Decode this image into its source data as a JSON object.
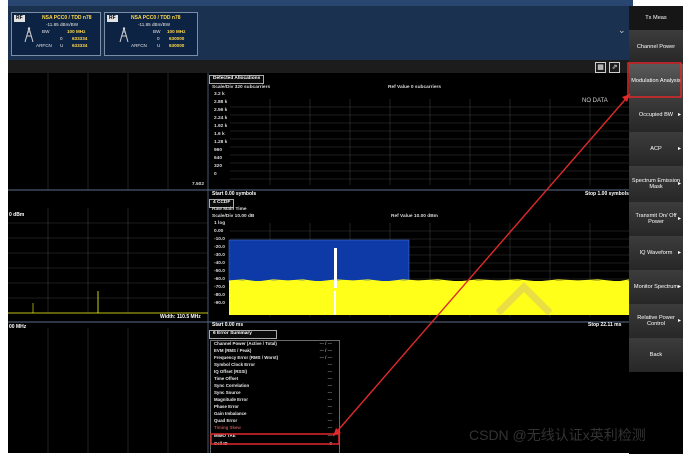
{
  "topbar": {
    "tile1": {
      "badge": "RF",
      "title": "NSA PCC0 / TDD  n78",
      "l1": "-11.85  dBm/BW",
      "l2a": "BW",
      "l2b": "100  MHz",
      "l3a": "0",
      "l3b": "633334",
      "l4a": "U",
      "l4b": "633334",
      "foot": "ARFCN"
    },
    "tile2": {
      "badge": "RF",
      "title": "NSA PCC0 / TDD  n78",
      "l1": "-11.85  dBm/BW",
      "l2a": "BW",
      "l2b": "100  MHz",
      "l3a": "0",
      "l3b": "630000",
      "l4a": "U",
      "l4b": "630000",
      "foot": "ARFCN"
    },
    "chevron": "⌄"
  },
  "softkeys": [
    {
      "label": "Tx Meas",
      "arrow": ""
    },
    {
      "label": "Channel Power",
      "arrow": ""
    },
    {
      "label": "Modulation Analysis",
      "arrow": ""
    },
    {
      "label": "Occupied BW",
      "arrow": "▸"
    },
    {
      "label": "ACP",
      "arrow": "▸"
    },
    {
      "label": "Spectrum Emission Mask",
      "arrow": "▸"
    },
    {
      "label": "Transmit On/ Off Power",
      "arrow": "▸"
    },
    {
      "label": "IQ Waveform",
      "arrow": "▸"
    },
    {
      "label": "Monitor Spectrum",
      "arrow": "▸"
    },
    {
      "label": "Relative Power Control",
      "arrow": "▸"
    },
    {
      "label": "Back",
      "arrow": ""
    }
  ],
  "top_panel": {
    "dropdown": "Detected Allocations",
    "scale": "Scale/Div 320 subcarriers",
    "ref": "Ref Value 0 subcarriers",
    "no_data": "NO DATA",
    "yticks": [
      "3.2 k",
      "2.88 k",
      "2.56 k",
      "2.24 k",
      "1.92 k",
      "1.6 k",
      "1.28 k",
      "960",
      "640",
      "320",
      "0"
    ],
    "left_value": "7.502",
    "start": "Start 0.00 symbols",
    "stop": "Stop 1.00 symbols"
  },
  "mid_panel": {
    "left_label": "0 dBm",
    "dropdown1": "4 CCDF",
    "dropdown2": "Raw Main Time",
    "scale": "Scale/Div 10.00 dB",
    "ref": "Ref Value 10.00 dBm",
    "yticks": [
      "1 log",
      "0.00",
      "-10.0",
      "-20.0",
      "-30.0",
      "-40.0",
      "-50.0",
      "-60.0",
      "-70.0",
      "-80.0",
      "-90.0"
    ],
    "width": "Width: 110.5 MHz",
    "freq": "00 MHz",
    "start": "Start 0.00 ms",
    "stop": "Stop 22.11 ms"
  },
  "bottom_panel": {
    "dropdown": "6 Error Summary",
    "rows": [
      {
        "k": "Channel Power (Active / Total)",
        "v": "--- / ---"
      },
      {
        "k": "EVM (RMS / Peak)",
        "v": "--- / ---"
      },
      {
        "k": "Frequency Error (RMS / Worst)",
        "v": "--- / ---"
      },
      {
        "k": "Symbol Clock Error",
        "v": "---"
      },
      {
        "k": "IQ Offset (RSSI)",
        "v": "---"
      },
      {
        "k": "Time Offset",
        "v": "---"
      },
      {
        "k": "Sync Correlation",
        "v": "---"
      },
      {
        "k": "Sync Source",
        "v": "---"
      },
      {
        "k": "Magnitude Error",
        "v": "---"
      },
      {
        "k": "Phase Error",
        "v": "---"
      },
      {
        "k": "Gain Imbalance",
        "v": "---"
      },
      {
        "k": "Quad Error",
        "v": "---"
      },
      {
        "k": "Timing Skew",
        "v": "---"
      },
      {
        "k": "MIMO TAE",
        "v": "---"
      },
      {
        "k": "Cell ID",
        "v": "0"
      }
    ]
  },
  "watermark": "CSDN @无线认证x英利检测",
  "colors": {
    "highlight": "#e0292b",
    "trace_yellow": "#ffff1a",
    "blue_box": "#0e3aa8"
  }
}
